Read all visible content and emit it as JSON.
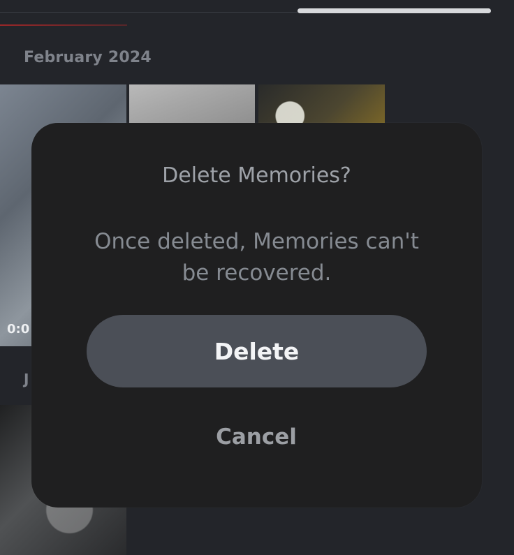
{
  "background": {
    "month_header": "February 2024",
    "next_section_initial": "J",
    "video_duration_partial": "0:0"
  },
  "dialog": {
    "title": "Delete Memories?",
    "message": "Once deleted, Memories can't be recovered.",
    "delete_label": "Delete",
    "cancel_label": "Cancel"
  },
  "colors": {
    "app_background": "#23252a",
    "dialog_background": "#1f1f20",
    "delete_button": "#4b4f57",
    "scroll_indicator": "#d7d9dc"
  }
}
